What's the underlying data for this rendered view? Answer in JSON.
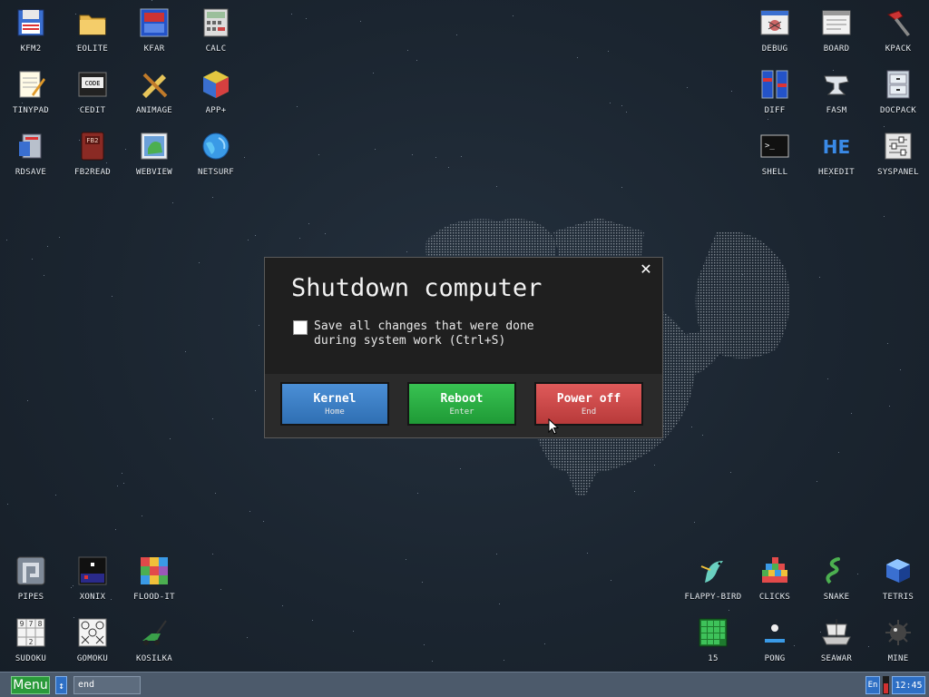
{
  "desktop": {
    "icons_top_left": [
      {
        "label": "KFM2",
        "icon": "floppy-icon"
      },
      {
        "label": "EOLITE",
        "icon": "folder-icon"
      },
      {
        "label": "KFAR",
        "icon": "kfar-icon"
      },
      {
        "label": "CALC",
        "icon": "calculator-icon"
      },
      {
        "label": "TINYPAD",
        "icon": "notepad-icon"
      },
      {
        "label": "CEDIT",
        "icon": "code-editor-icon"
      },
      {
        "label": "ANIMAGE",
        "icon": "pencil-ruler-icon"
      },
      {
        "label": "APP+",
        "icon": "cube-icon"
      },
      {
        "label": "RDSAVE",
        "icon": "ram-disk-icon"
      },
      {
        "label": "FB2READ",
        "icon": "book-icon"
      },
      {
        "label": "WEBVIEW",
        "icon": "map-icon"
      },
      {
        "label": "NETSURF",
        "icon": "globe-icon"
      }
    ],
    "icons_top_right": [
      {
        "label": "DEBUG",
        "icon": "bug-window-icon"
      },
      {
        "label": "BOARD",
        "icon": "board-window-icon"
      },
      {
        "label": "KPACK",
        "icon": "hammer-icon"
      },
      {
        "label": "DIFF",
        "icon": "diff-icon"
      },
      {
        "label": "FASM",
        "icon": "anvil-icon"
      },
      {
        "label": "DOCPACK",
        "icon": "cabinet-icon"
      },
      {
        "label": "SHELL",
        "icon": "terminal-icon"
      },
      {
        "label": "HEXEDIT",
        "icon": "hex-icon"
      },
      {
        "label": "SYSPANEL",
        "icon": "sliders-icon"
      }
    ],
    "icons_bottom_left": [
      {
        "label": "PIPES",
        "icon": "pipes-icon"
      },
      {
        "label": "XONIX",
        "icon": "xonix-icon"
      },
      {
        "label": "FLOOD-IT",
        "icon": "flood-grid-icon"
      },
      {
        "label": "SUDOKU",
        "icon": "sudoku-icon"
      },
      {
        "label": "GOMOKU",
        "icon": "gomoku-icon"
      },
      {
        "label": "KOSILKA",
        "icon": "lawnmower-icon"
      }
    ],
    "icons_bottom_right": [
      {
        "label": "FLAPPY-BIRD",
        "icon": "bird-icon"
      },
      {
        "label": "CLICKS",
        "icon": "clicks-icon"
      },
      {
        "label": "SNAKE",
        "icon": "snake-icon"
      },
      {
        "label": "TETRIS",
        "icon": "tetris-icon"
      },
      {
        "label": "15",
        "icon": "fifteen-icon"
      },
      {
        "label": "PONG",
        "icon": "pong-icon"
      },
      {
        "label": "SEAWAR",
        "icon": "ship-icon"
      },
      {
        "label": "MINE",
        "icon": "mine-icon"
      }
    ]
  },
  "dialog": {
    "title": "Shutdown computer",
    "close_glyph": "✕",
    "checkbox_label_line1": "Save all changes that were done",
    "checkbox_label_line2": "during system work (Ctrl+S)",
    "checkbox_checked": false,
    "buttons": {
      "kernel": {
        "label": "Kernel",
        "hotkey": "Home",
        "color": "#3f80c8"
      },
      "reboot": {
        "label": "Reboot",
        "hotkey": "Enter",
        "color": "#2bb046"
      },
      "power": {
        "label": "Power off",
        "hotkey": "End",
        "color": "#cc4747"
      }
    }
  },
  "taskbar": {
    "menu_label": "Menu",
    "swap_glyph": "↕",
    "task_field_value": "end",
    "lang": "En",
    "clock": "12:45"
  }
}
